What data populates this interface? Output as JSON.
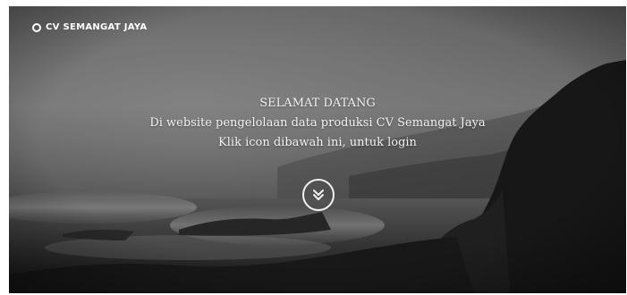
{
  "navbar": {
    "brand_label": "CV SEMANGAT JAYA",
    "brand_icon": "circle-dot-icon"
  },
  "hero": {
    "title": "SELAMAT DATANG",
    "subtitle": "Di website pengelolaan data produksi CV Semangat Jaya",
    "instruction": "Klik icon dibawah ini, untuk login",
    "scroll_icon": "double-chevron-down-icon"
  },
  "colors": {
    "text": "#f2f2f2",
    "overlay": "#2a2a2a"
  }
}
